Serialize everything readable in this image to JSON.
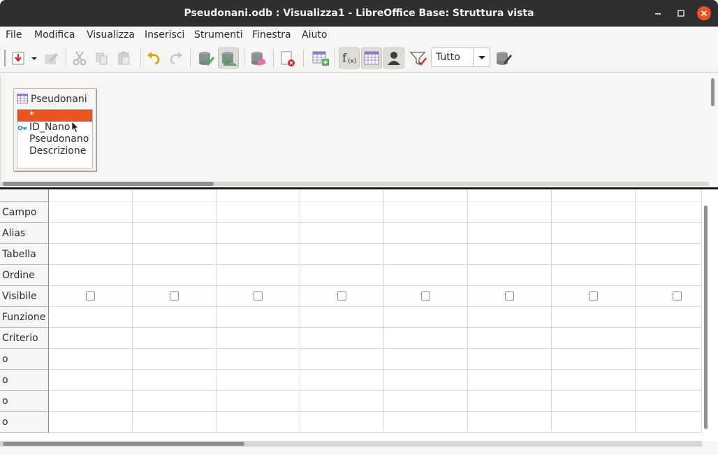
{
  "window": {
    "title": "Pseudonani.odb : Visualizza1 - LibreOffice Base: Struttura vista",
    "accent_color": "#e95420"
  },
  "menu": {
    "items": [
      "File",
      "Modifica",
      "Visualizza",
      "Inserisci",
      "Strumenti",
      "Finestra",
      "Aiuto"
    ]
  },
  "toolbar": {
    "limit_value": "Tutto",
    "icons": [
      "save-icon",
      "dropdown-arrow-icon",
      "edit-icon",
      "cut-icon",
      "copy-icon",
      "paste-icon",
      "undo-icon",
      "redo-icon",
      "run-query-icon",
      "toggle-design-icon",
      "clear-query-icon",
      "close-icon",
      "add-table-icon",
      "functions-icon",
      "table-name-icon",
      "alias-icon",
      "distinct-icon",
      "sql-native-icon"
    ]
  },
  "table_window": {
    "name": "Pseudonani",
    "fields": [
      {
        "label": "*",
        "selected": true,
        "key": false
      },
      {
        "label": "ID_Nano",
        "selected": false,
        "key": true
      },
      {
        "label": "Pseudonano",
        "selected": false,
        "key": false
      },
      {
        "label": "Descrizione",
        "selected": false,
        "key": false
      }
    ]
  },
  "design_grid": {
    "row_labels": [
      "Campo",
      "Alias",
      "Tabella",
      "Ordine",
      "Visibile",
      "Funzione",
      "Criterio",
      "o",
      "o",
      "o",
      "o"
    ],
    "column_count": 8,
    "visible_checked": [
      false,
      false,
      false,
      false,
      false,
      false,
      false,
      false
    ]
  }
}
